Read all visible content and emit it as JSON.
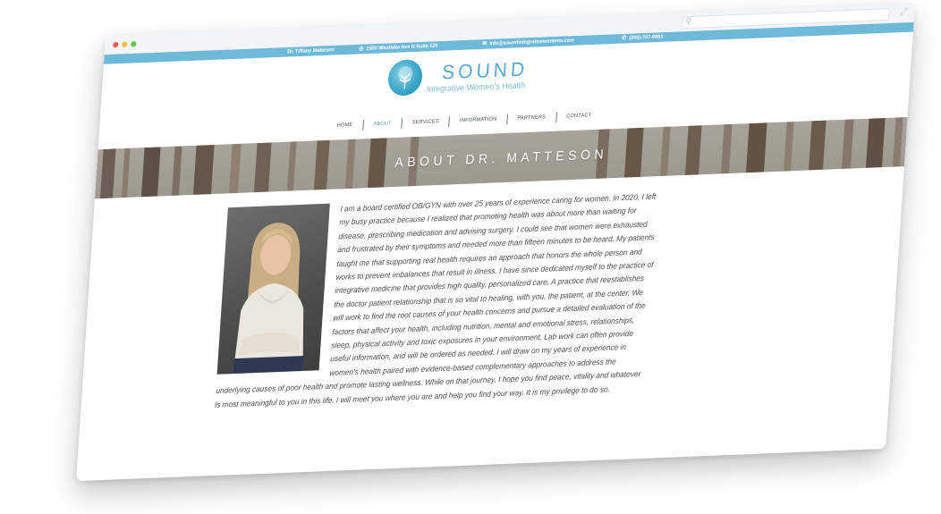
{
  "browser": {
    "search_icon": "search-icon",
    "expand_icon": "expand-icon"
  },
  "topbar": {
    "name": "Dr. Tiffany Matteson",
    "address": "1500 Westlake Ave N Suite 120",
    "email": "info@soundintegrativewomens.com",
    "phone": "(206)-707-9893",
    "color": "#6fb9d8"
  },
  "logo": {
    "title": "SOUND",
    "subtitle": "Integrative Women's Health",
    "color": "#56a8cd"
  },
  "nav": {
    "items": [
      {
        "label": "HOME"
      },
      {
        "label": "ABOUT"
      },
      {
        "label": "SERVICES"
      },
      {
        "label": "INFORMATION"
      },
      {
        "label": "PARTNERS"
      },
      {
        "label": "CONTACT"
      }
    ],
    "active": "ABOUT"
  },
  "hero": {
    "title": "ABOUT DR. MATTESON"
  },
  "bio": {
    "text": "I am a board certified OB/GYN with over 25 years of experience caring for women. In 2020, I left my busy practice because I realized that promoting health was about more than waiting for disease, prescribing medication and advising surgery. I could see that women were exhausted and frustrated by their symptoms and needed more than fifteen minutes to be heard. My patients taught me that supporting real health requires an approach that honors the whole person and works to prevent imbalances that result in illness. I have since dedicated myself to the practice of integrative medicine that provides high quality, personalized care. A practice that reestablishes the doctor patient relationship that is so vital to healing, with you, the patient, at the center. We will work to find the root causes of your health concerns and pursue a detailed evaluation of the factors that affect your health, including nutrition, mental and emotional stress, relationships, sleep, physical activity and toxic exposures in your environment. Lab work can often provide useful information, and will be ordered as needed. I will draw on my years of experience in women's health paired with evidence-based complementary approaches to address the underlying causes of poor health and promote lasting wellness. While on that journey, I hope you find peace, vitality and whatever is most meaningful to you in this life. I will meet you where you are and help you find your way. It is my privilege to do so."
  }
}
